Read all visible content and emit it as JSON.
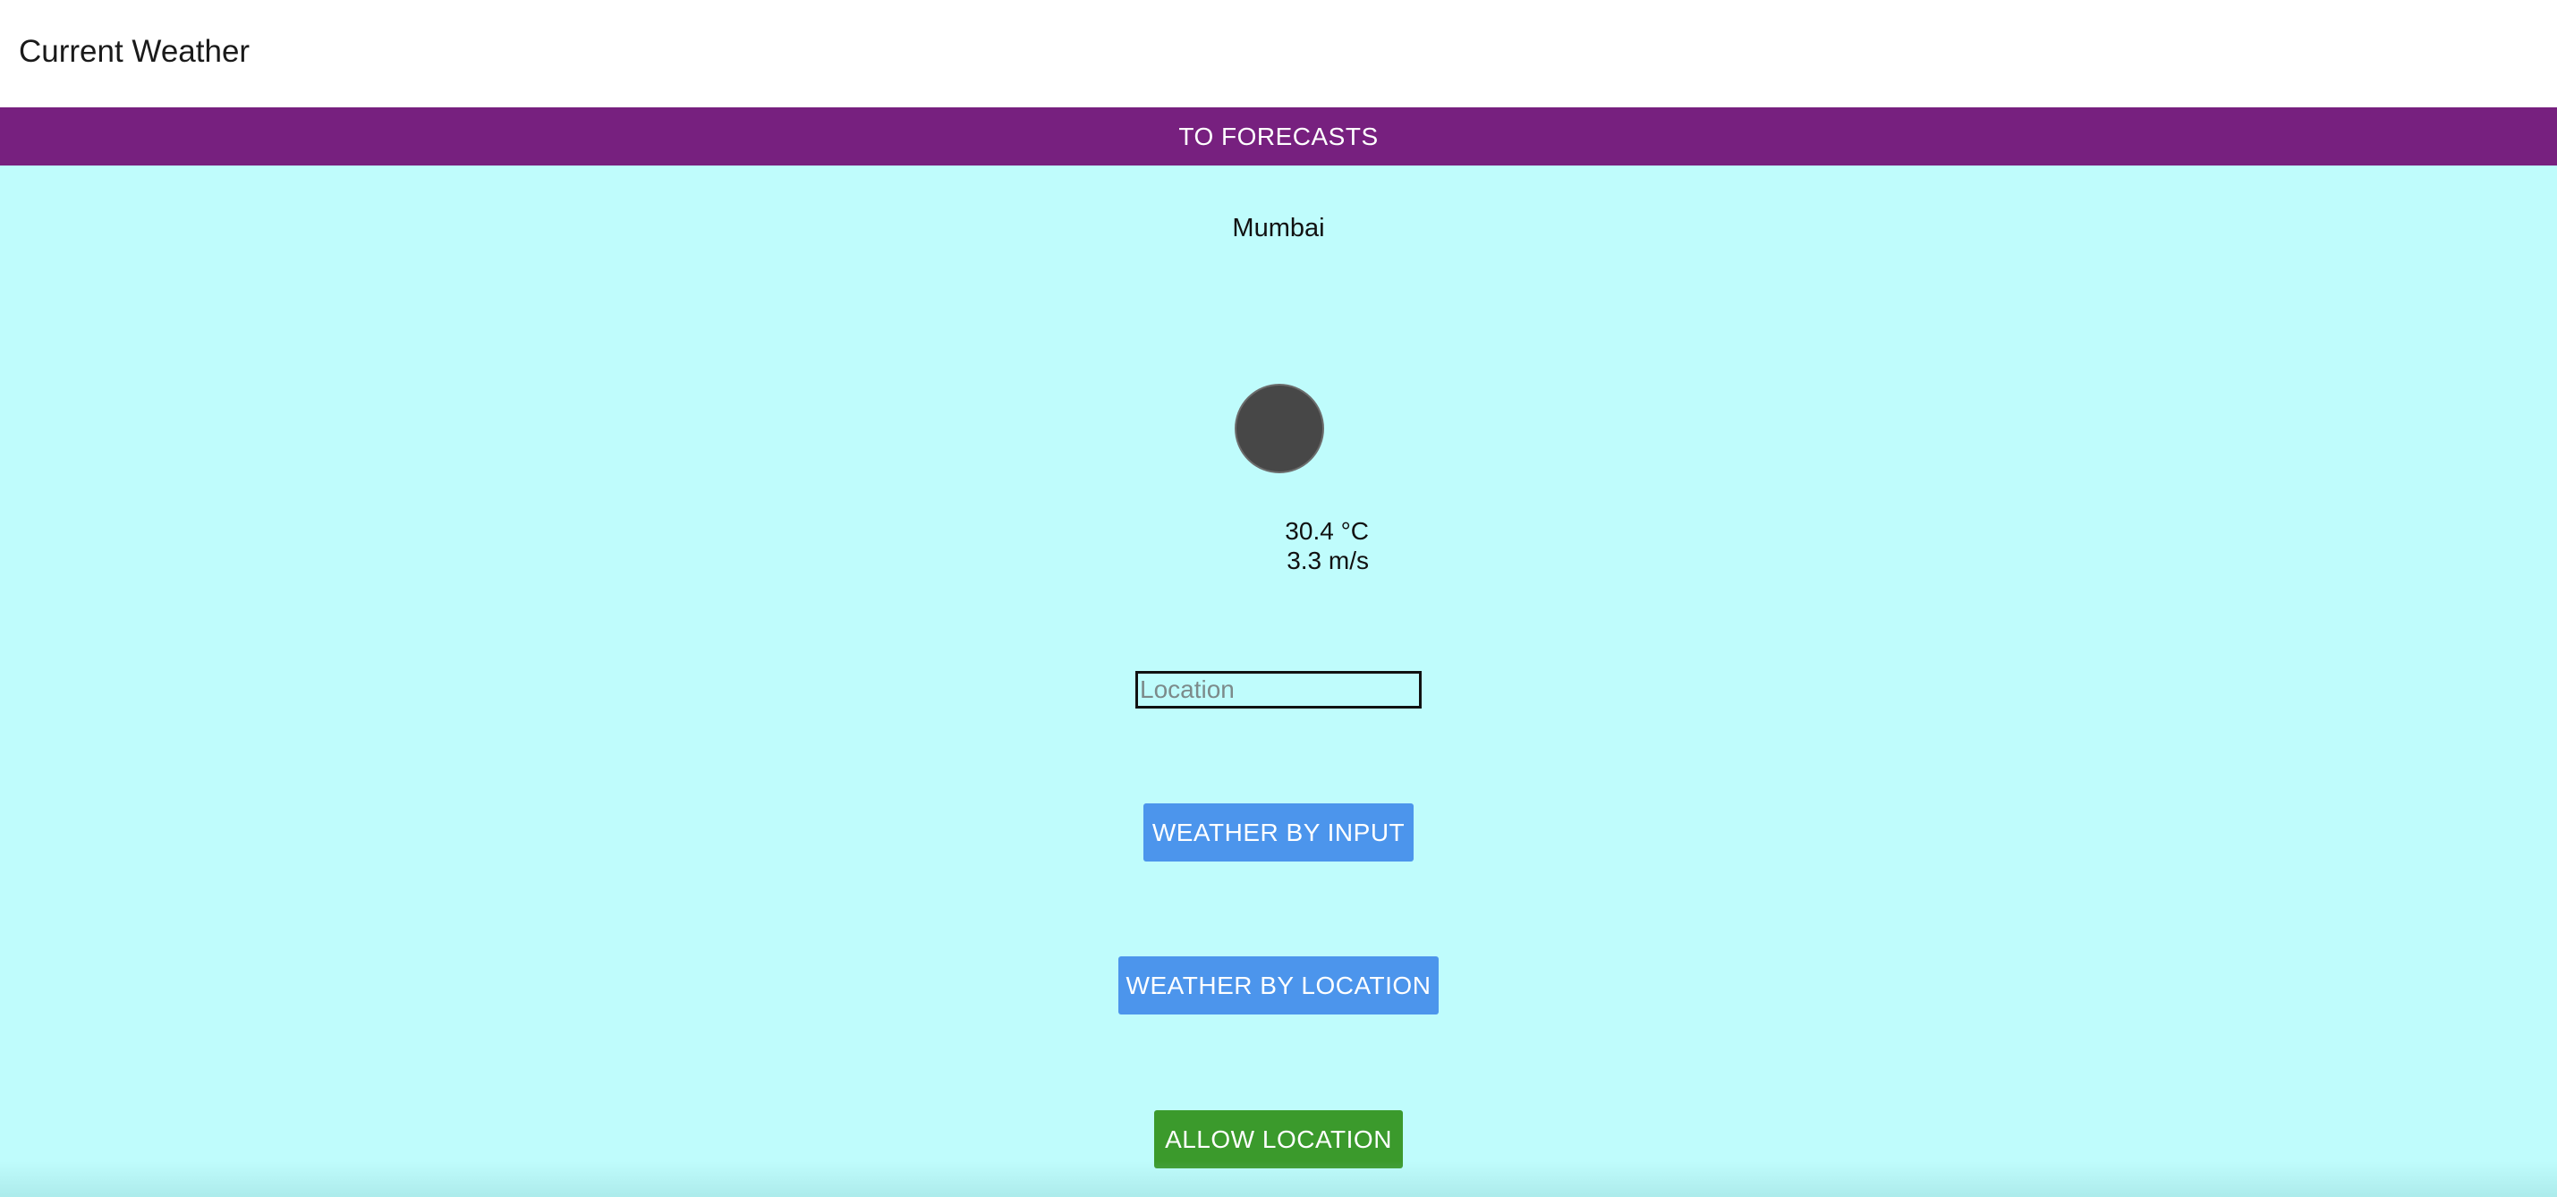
{
  "header": {
    "title": "Current Weather"
  },
  "nav": {
    "forecasts_label": "TO FORECASTS"
  },
  "weather": {
    "city": "Mumbai",
    "icon": "weather-condition-icon",
    "temperature": "30.4 °C",
    "wind_speed": "3.3 m/s"
  },
  "search": {
    "value": "",
    "placeholder": "Location"
  },
  "actions": {
    "by_input_label": "WEATHER BY INPUT",
    "by_location_label": "WEATHER BY LOCATION",
    "allow_location_label": "ALLOW LOCATION"
  },
  "colors": {
    "background": "#bffcfc",
    "nav_bar": "#77207f",
    "primary_button": "#4c95ec",
    "allow_button": "#3b9a2c"
  }
}
